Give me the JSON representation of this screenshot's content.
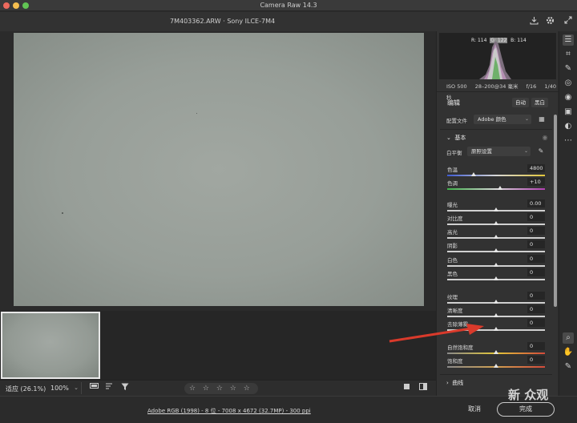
{
  "window": {
    "title": "Camera Raw 14.3"
  },
  "header": {
    "file_title": "7M403362.ARW  ·  Sony ILCE-7M4"
  },
  "histogram": {
    "r_label": "R:",
    "r": "114",
    "g_label": "G:",
    "g": "122",
    "b_label": "B:",
    "b": "114"
  },
  "camera_info": {
    "iso": "ISO 500",
    "lens": "28–200@34 毫米",
    "aperture": "f/16",
    "shutter": "1/40 秒"
  },
  "edit": {
    "title": "编辑",
    "auto_label": "自动",
    "bw_label": "黑白",
    "profile_label": "配置文件",
    "profile_value": "Adobe 颜色",
    "basic_title": "基本",
    "wb_label": "白平衡",
    "wb_value": "原照设置",
    "sliders": [
      {
        "label": "色温",
        "value": "4800",
        "pos": 0.27
      },
      {
        "label": "色调",
        "value": "+10",
        "pos": 0.54
      },
      {
        "label": "曝光",
        "value": "0.00",
        "pos": 0.5
      },
      {
        "label": "对比度",
        "value": "0",
        "pos": 0.5
      },
      {
        "label": "高光",
        "value": "0",
        "pos": 0.5
      },
      {
        "label": "阴影",
        "value": "0",
        "pos": 0.5
      },
      {
        "label": "白色",
        "value": "0",
        "pos": 0.5
      },
      {
        "label": "黑色",
        "value": "0",
        "pos": 0.5
      },
      {
        "label": "纹理",
        "value": "0",
        "pos": 0.5
      },
      {
        "label": "清晰度",
        "value": "0",
        "pos": 0.5
      },
      {
        "label": "去除薄雾",
        "value": "0",
        "pos": 0.5
      },
      {
        "label": "自然饱和度",
        "value": "0",
        "pos": 0.5
      },
      {
        "label": "饱和度",
        "value": "0",
        "pos": 0.5
      }
    ],
    "curve_title": "曲线"
  },
  "bottom": {
    "zoom_label": "适应 (26.1%)",
    "zoom_value": "100%",
    "stars": "☆ ☆ ☆ ☆ ☆"
  },
  "footer": {
    "info_link": "Adobe RGB (1998) - 8 位 - 7008 x 4672 (32.7MP) - 300 ppi",
    "cancel": "取消",
    "done": "完成"
  },
  "watermark": "新 众观",
  "colors": {
    "annotation_arrow": "#d93a2b",
    "panel_bg": "#323232",
    "photo": "#979e98"
  },
  "icons": [
    "save-icon",
    "gear-icon",
    "fullscreen-icon",
    "sliders-icon",
    "crop-icon",
    "healing-icon",
    "mask-icon",
    "redeye-icon",
    "presets-icon",
    "snapshots-icon",
    "more-icon",
    "zoom-icon",
    "hand-icon",
    "eyedropper-icon"
  ]
}
